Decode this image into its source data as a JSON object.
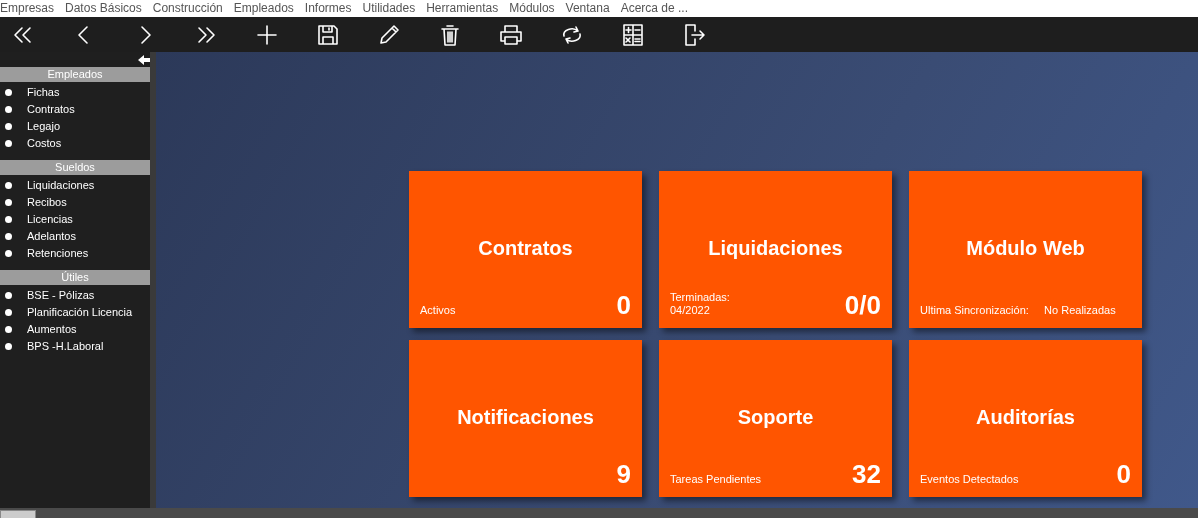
{
  "menu": [
    "Empresas",
    "Datos Básicos",
    "Construcción",
    "Empleados",
    "Informes",
    "Utilidades",
    "Herramientas",
    "Módulos",
    "Ventana",
    "Acerca de ..."
  ],
  "sidebar": {
    "sections": [
      {
        "title": "Empleados",
        "items": [
          "Fichas",
          "Contratos",
          "Legajo",
          "Costos"
        ]
      },
      {
        "title": "Sueldos",
        "items": [
          "Liquidaciones",
          "Recibos",
          "Licencias",
          "Adelantos",
          "Retenciones"
        ]
      },
      {
        "title": "Útiles",
        "items": [
          "BSE - Pólizas",
          "Planificación Licencia",
          "Aumentos",
          "BPS -H.Laboral"
        ]
      }
    ]
  },
  "tiles": [
    {
      "title": "Contratos",
      "caption": "Activos",
      "value": "0"
    },
    {
      "title": "Liquidaciones",
      "caption": "Terminadas:\n04/2022",
      "value": "0/0"
    },
    {
      "title": "Módulo Web",
      "caption": "Ultima Sincronización:     No Realizadas"
    },
    {
      "title": "Notificaciones",
      "value": "9"
    },
    {
      "title": "Soporte",
      "caption": "Tareas Pendientes",
      "value": "32"
    },
    {
      "title": "Auditorías",
      "caption": "Eventos Detectados",
      "value": "0"
    }
  ]
}
